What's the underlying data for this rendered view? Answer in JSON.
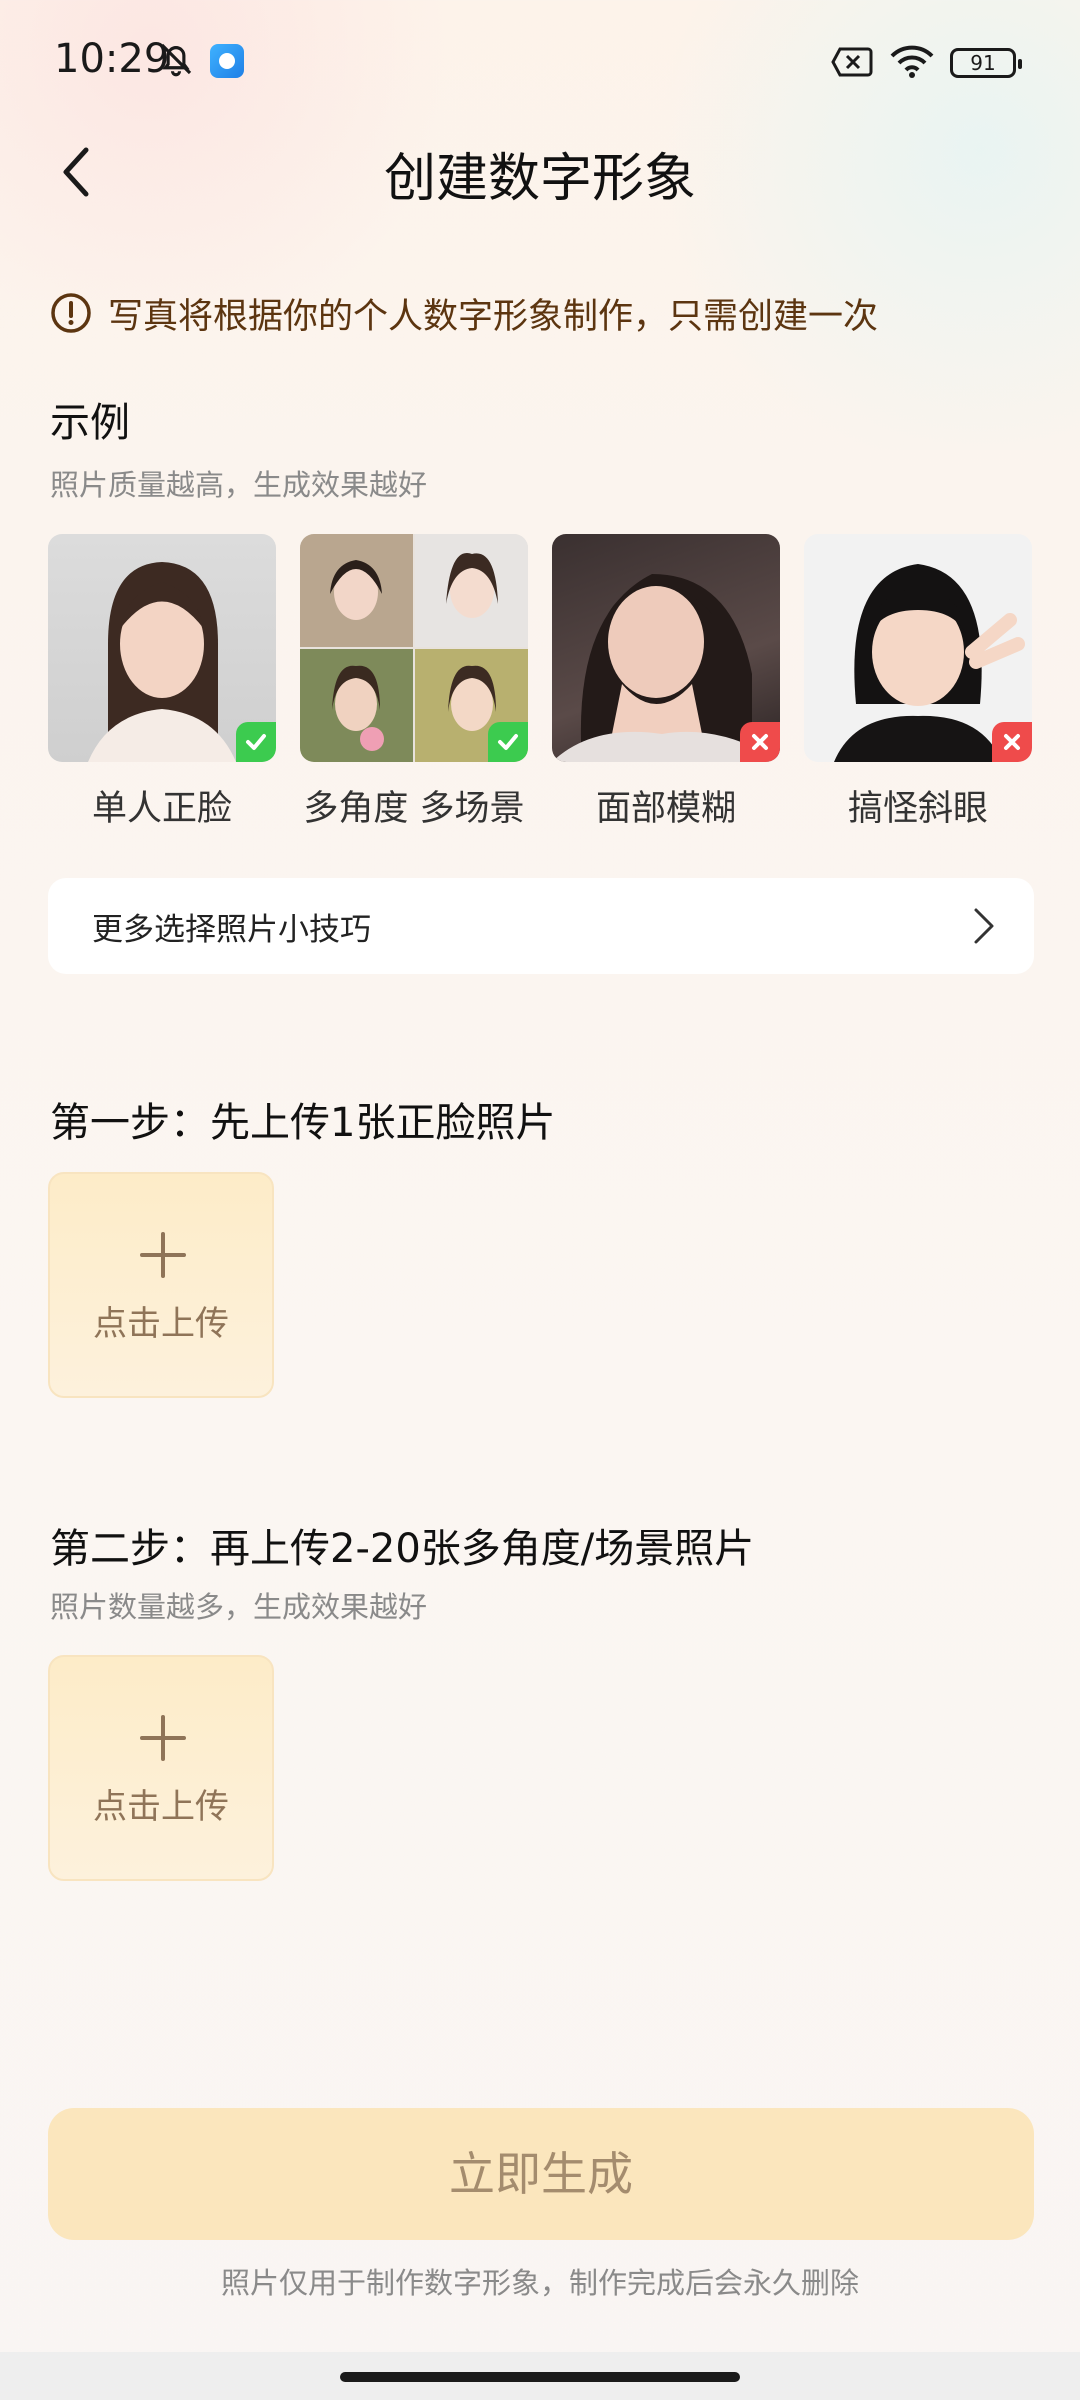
{
  "status_bar": {
    "time": "10:29",
    "battery": "91"
  },
  "header": {
    "title": "创建数字形象"
  },
  "notice": {
    "text": "写真将根据你的个人数字形象制作，只需创建一次"
  },
  "examples": {
    "title": "示例",
    "subtitle": "照片质量越高，生成效果越好",
    "items": [
      {
        "label": "单人正脸",
        "status": "ok"
      },
      {
        "label": "多角度 多场景",
        "status": "ok"
      },
      {
        "label": "面部模糊",
        "status": "bad"
      },
      {
        "label": "搞怪斜眼",
        "status": "bad"
      }
    ]
  },
  "tips": {
    "label": "更多选择照片小技巧"
  },
  "step1": {
    "title": "第一步：先上传1张正脸照片",
    "upload_label": "点击上传"
  },
  "step2": {
    "title": "第二步：再上传2-20张多角度/场景照片",
    "subtitle": "照片数量越多，生成效果越好",
    "upload_label": "点击上传"
  },
  "generate": {
    "label": "立即生成"
  },
  "footer": {
    "text": "照片仅用于制作数字形象，制作完成后会永久删除"
  },
  "colors": {
    "accent": "#fbe6bd",
    "ok": "#3ccb4f",
    "bad": "#ef4b4b",
    "notice_text": "#5c3510"
  }
}
